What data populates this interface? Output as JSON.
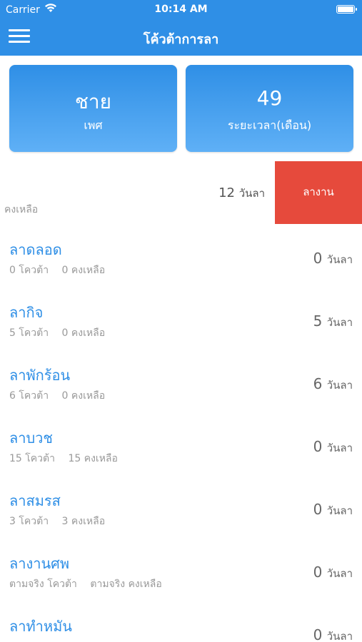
{
  "status_bar": {
    "carrier": "Carrier",
    "time": "10:14 AM"
  },
  "nav": {
    "title": "โค้วต้าการลา"
  },
  "cards": {
    "gender": {
      "value": "ชาย",
      "label": "เพศ"
    },
    "duration": {
      "value": "49",
      "label": "ระยะเวลา(เดือน)"
    }
  },
  "summary": {
    "days_value": "12",
    "days_unit": "วันลา",
    "remaining_label": "คงเหลือ",
    "leave_button": "ลางาน"
  },
  "leave_types": [
    {
      "name": "ลาดลอด",
      "quota": "0",
      "quota_label": "โควต้า",
      "remaining": "0",
      "remaining_label": "คงเหลือ",
      "days": "0",
      "days_unit": "วันลา"
    },
    {
      "name": "ลากิจ",
      "quota": "5",
      "quota_label": "โควต้า",
      "remaining": "0",
      "remaining_label": "คงเหลือ",
      "days": "5",
      "days_unit": "วันลา"
    },
    {
      "name": "ลาพักร้อน",
      "quota": "6",
      "quota_label": "โควต้า",
      "remaining": "0",
      "remaining_label": "คงเหลือ",
      "days": "6",
      "days_unit": "วันลา"
    },
    {
      "name": "ลาบวช",
      "quota": "15",
      "quota_label": "โควต้า",
      "remaining": "15",
      "remaining_label": "คงเหลือ",
      "days": "0",
      "days_unit": "วันลา"
    },
    {
      "name": "ลาสมรส",
      "quota": "3",
      "quota_label": "โควต้า",
      "remaining": "3",
      "remaining_label": "คงเหลือ",
      "days": "0",
      "days_unit": "วันลา"
    },
    {
      "name": "ลางานศพ",
      "quota": "ตามจริง",
      "quota_label": "โควต้า",
      "remaining": "ตามจริง",
      "remaining_label": "คงเหลือ",
      "days": "0",
      "days_unit": "วันลา"
    },
    {
      "name": "ลาทำหมัน",
      "quota": "",
      "quota_label": "",
      "remaining": "",
      "remaining_label": "",
      "days": "0",
      "days_unit": "วันลา"
    }
  ],
  "colors": {
    "primary": "#2f8fe6",
    "accent": "#e64a3c"
  },
  "icons": {
    "menu": "hamburger-menu-icon",
    "wifi": "wifi-icon",
    "battery": "battery-icon"
  }
}
